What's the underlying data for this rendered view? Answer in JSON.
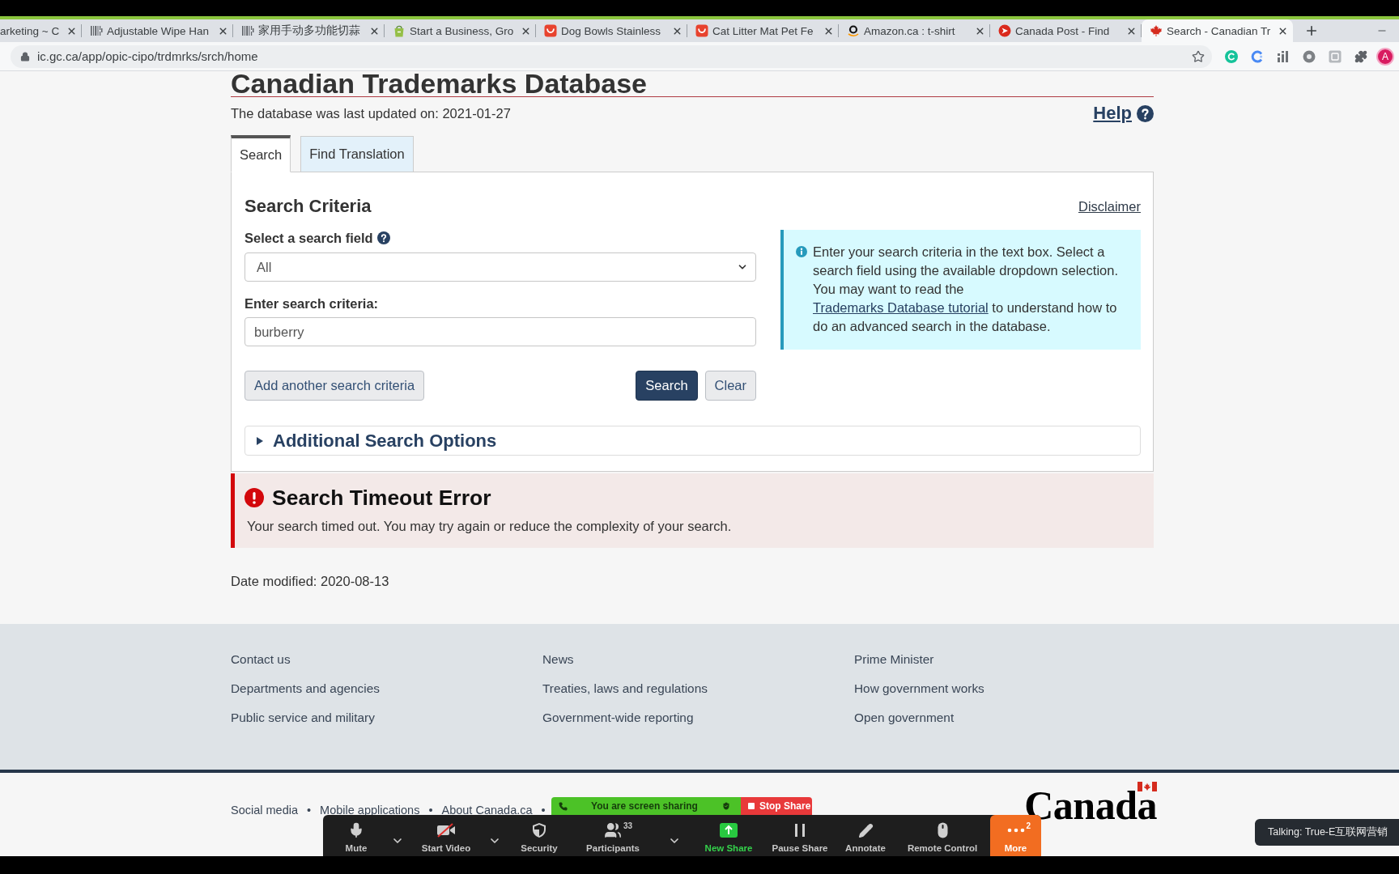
{
  "browser": {
    "tabs": [
      {
        "title": "arketing ~ C",
        "kind": "none",
        "selected": false
      },
      {
        "title": "Adjustable Wipe Han",
        "kind": "barcode",
        "selected": false
      },
      {
        "title": "家用手动多功能切蒜",
        "kind": "barcode",
        "selected": false
      },
      {
        "title": "Start a Business, Gro",
        "kind": "bag",
        "selected": false
      },
      {
        "title": "Dog Bowls Stainless",
        "kind": "tile",
        "selected": false
      },
      {
        "title": "Cat Litter Mat Pet Fe",
        "kind": "tile",
        "selected": false
      },
      {
        "title": "Amazon.ca : t-shirt",
        "kind": "smile",
        "selected": false
      },
      {
        "title": "Canada Post - Find",
        "kind": "arrow",
        "selected": false
      },
      {
        "title": "Search - Canadian Tr",
        "kind": "leaf",
        "selected": true
      }
    ],
    "url": "ic.gc.ca/app/opic-cipo/trdmrks/srch/home",
    "profile_initial": "A"
  },
  "page": {
    "title": "Canadian Trademarks Database",
    "updated": "The database was last updated on: 2021-01-27",
    "help": "Help",
    "tabs": [
      {
        "label": "Search",
        "selected": true
      },
      {
        "label": "Find Translation",
        "selected": false
      }
    ],
    "criteria": {
      "heading": "Search Criteria",
      "disclaimer": "Disclaimer",
      "field_label": "Select a search field",
      "field_value": "All",
      "text_label": "Enter search criteria:",
      "text_value": "burberry",
      "add_button": "Add another search criteria",
      "search_button": "Search",
      "clear_button": "Clear"
    },
    "info": {
      "before": "Enter your search criteria in the text box. Select a search field using the available dropdown selection. You may want to read the",
      "link": "Trademarks Database tutorial",
      "after": "to understand how to do an advanced search in the database."
    },
    "more_options": {
      "label": "Additional Search Options",
      "expanded": false
    },
    "error": {
      "title": "Search Timeout Error",
      "message": "Your search timed out. You may try again or reduce the complexity of your search."
    },
    "date_modified": "Date modified: 2020-08-13"
  },
  "footer": {
    "columns": [
      {
        "links": [
          "Contact us",
          "Departments and agencies",
          "Public service and military"
        ]
      },
      {
        "links": [
          "News",
          "Treaties, laws and regulations",
          "Government-wide reporting"
        ]
      },
      {
        "links": [
          "Prime Minister",
          "How government works",
          "Open government"
        ]
      }
    ],
    "bottom_links": [
      "Social media",
      "Mobile applications",
      "About Canada.ca"
    ],
    "separator": "•",
    "wordmark": "Canada"
  },
  "meeting": {
    "share_status": "You are screen sharing",
    "stop_share": "Stop Share",
    "controls": [
      {
        "kind": "mic",
        "label": "Mute"
      },
      {
        "kind": "caret"
      },
      {
        "kind": "video",
        "label": "Start Video"
      },
      {
        "kind": "caret"
      },
      {
        "kind": "shield",
        "label": "Security"
      },
      {
        "kind": "people",
        "label": "Participants",
        "badge": "33"
      },
      {
        "kind": "caret"
      },
      {
        "kind": "share",
        "label": "New Share"
      },
      {
        "kind": "pause",
        "label": "Pause Share"
      },
      {
        "kind": "pen",
        "label": "Annotate"
      },
      {
        "kind": "mouse",
        "label": "Remote Control"
      },
      {
        "kind": "more",
        "label": "More",
        "badge": "2"
      }
    ],
    "talking": "Talking: True-E互联网营销"
  }
}
